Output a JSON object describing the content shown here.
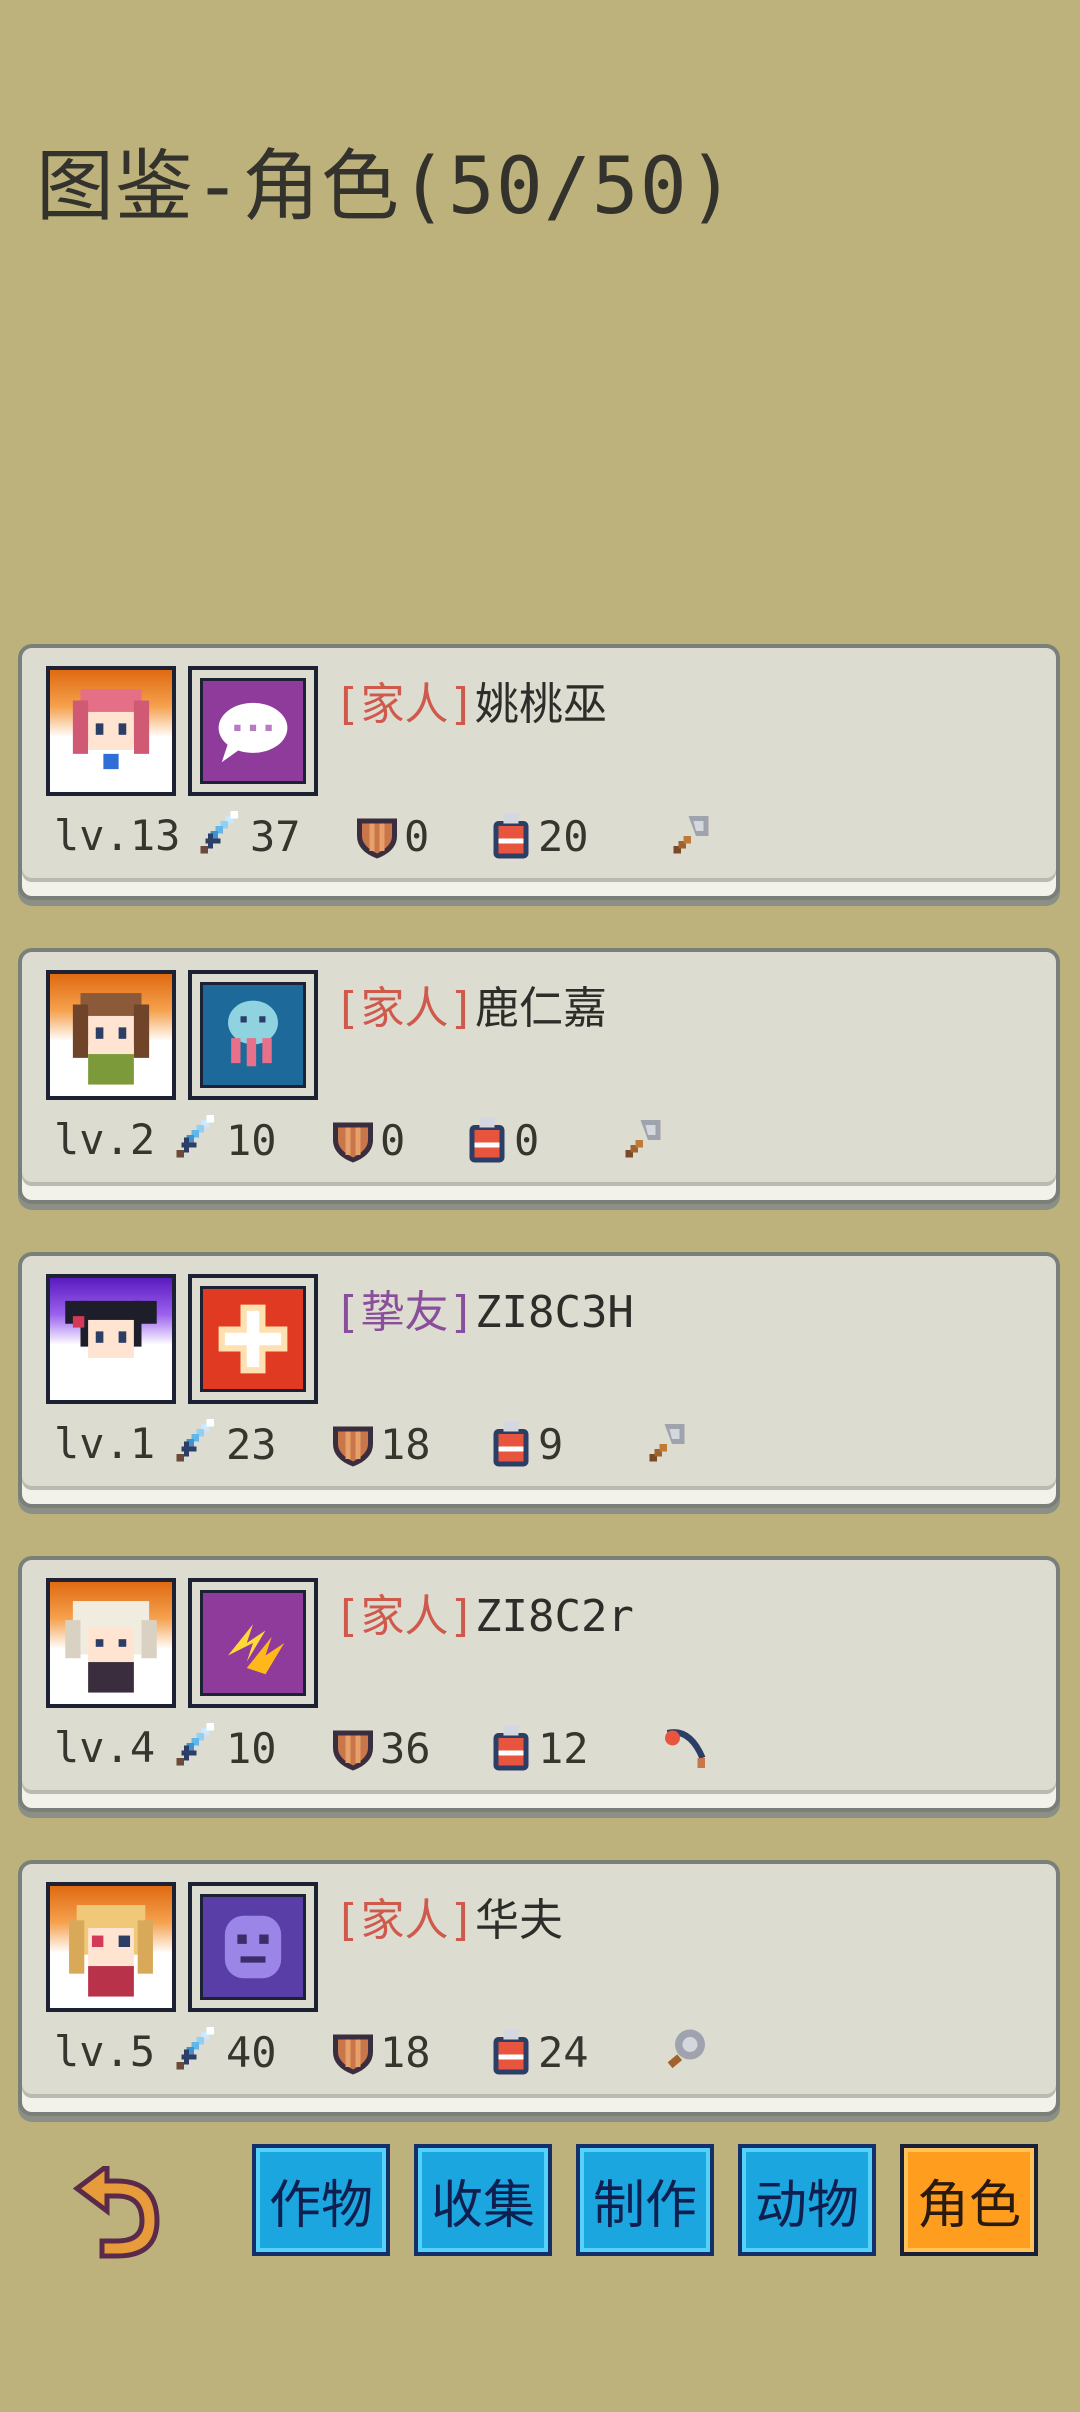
{
  "title": "图鉴-角色(50/50)",
  "characters": [
    {
      "tag": "[家人]",
      "name": "姚桃巫",
      "level": "lv.13",
      "attack": "37",
      "defense": "0",
      "pack": "20",
      "tool": "axe",
      "portrait_bg": "orange",
      "skill": "chat",
      "tag_type": "family"
    },
    {
      "tag": "[家人]",
      "name": "鹿仁嘉",
      "level": "lv.2",
      "attack": "10",
      "defense": "0",
      "pack": "0",
      "tool": "axe",
      "portrait_bg": "orange",
      "skill": "squid",
      "tag_type": "family"
    },
    {
      "tag": "[挚友]",
      "name": "ZI8C3H",
      "level": "lv.1",
      "attack": "23",
      "defense": "18",
      "pack": "9",
      "tool": "axe",
      "portrait_bg": "purple",
      "skill": "heal",
      "tag_type": "friend"
    },
    {
      "tag": "[家人]",
      "name": "ZI8C2r",
      "level": "lv.4",
      "attack": "10",
      "defense": "36",
      "pack": "12",
      "tool": "fishing-rod",
      "portrait_bg": "orange",
      "skill": "lightning",
      "tag_type": "family"
    },
    {
      "tag": "[家人]",
      "name": "华夫",
      "level": "lv.5",
      "attack": "40",
      "defense": "18",
      "pack": "24",
      "tool": "shovel",
      "portrait_bg": "orange",
      "skill": "ghost",
      "tag_type": "family"
    }
  ],
  "tabs": [
    {
      "label": "作物",
      "active": false
    },
    {
      "label": "收集",
      "active": false
    },
    {
      "label": "制作",
      "active": false
    },
    {
      "label": "动物",
      "active": false
    },
    {
      "label": "角色",
      "active": true
    }
  ],
  "colors": {
    "background": "#bdb27b",
    "tab": "#1ba6df",
    "tab_active": "#ff9d1e",
    "family_tag": "#cf5a4b",
    "friend_tag": "#8a4f9a"
  }
}
